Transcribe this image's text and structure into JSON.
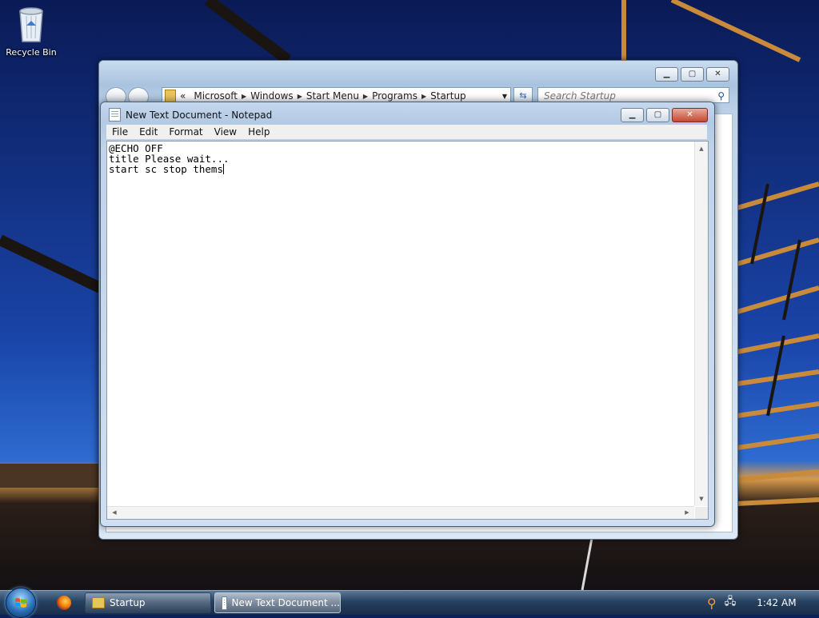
{
  "desktop": {
    "recycle_bin_label": "Recycle Bin"
  },
  "explorer": {
    "breadcrumb": {
      "overflow": "«",
      "items": [
        "Microsoft",
        "Windows",
        "Start Menu",
        "Programs",
        "Startup"
      ]
    },
    "search_placeholder": "Search Startup"
  },
  "notepad": {
    "title": "New Text Document - Notepad",
    "menu": [
      "File",
      "Edit",
      "Format",
      "View",
      "Help"
    ],
    "content_lines": [
      "@ECHO OFF",
      "title Please wait...",
      "start sc stop thems"
    ]
  },
  "taskbar": {
    "items": [
      {
        "label": "Startup"
      },
      {
        "label": "New Text Document ..."
      }
    ],
    "clock": "1:42 AM"
  },
  "colors": {
    "taskbar": "#26405f",
    "window_frame": "#b3cae4",
    "close_button": "#c34a32"
  }
}
